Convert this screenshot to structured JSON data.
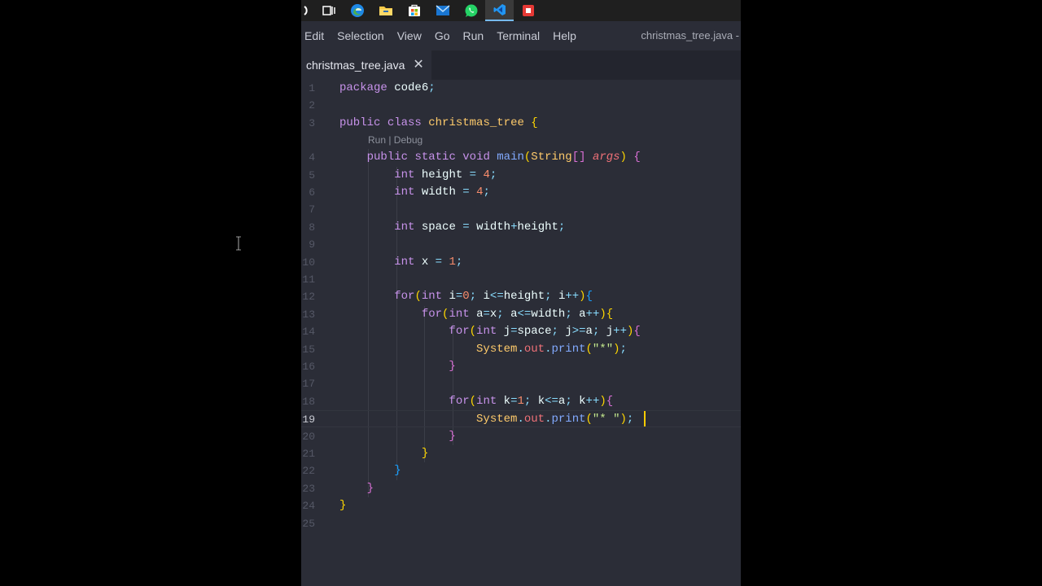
{
  "taskbar": {
    "icons": [
      "power-icon",
      "task-view-icon",
      "edge-browser-icon",
      "file-explorer-icon",
      "store-icon",
      "mail-icon",
      "whatsapp-icon",
      "vscode-icon",
      "office-icon"
    ]
  },
  "menu": {
    "items": [
      "Edit",
      "Selection",
      "View",
      "Go",
      "Run",
      "Terminal",
      "Help"
    ],
    "window_title": "christmas_tree.java -"
  },
  "tab": {
    "label": "christmas_tree.java",
    "close": "✕"
  },
  "editor": {
    "codelens": "Run | Debug",
    "current_line": 19,
    "lines": [
      {
        "n": "1",
        "text": "package code6;"
      },
      {
        "n": "2",
        "text": ""
      },
      {
        "n": "3",
        "text": "public class christmas_tree {"
      },
      {
        "n": "4",
        "text": "    public static void main(String[] args) {"
      },
      {
        "n": "5",
        "text": "        int height = 4;"
      },
      {
        "n": "6",
        "text": "        int width = 4;"
      },
      {
        "n": "7",
        "text": ""
      },
      {
        "n": "8",
        "text": "        int space = width+height;"
      },
      {
        "n": "9",
        "text": ""
      },
      {
        "n": "10",
        "text": "        int x = 1;"
      },
      {
        "n": "11",
        "text": ""
      },
      {
        "n": "12",
        "text": "        for(int i=0; i<=height; i++){"
      },
      {
        "n": "13",
        "text": "            for(int a=x; a<=width; a++){"
      },
      {
        "n": "14",
        "text": "                for(int j=space; j>=a; j++){"
      },
      {
        "n": "15",
        "text": "                    System.out.print(\"*\");"
      },
      {
        "n": "16",
        "text": "                }"
      },
      {
        "n": "17",
        "text": ""
      },
      {
        "n": "18",
        "text": "                for(int k=1; k<=a; k++){"
      },
      {
        "n": "19",
        "text": "                    System.out.print(\"* \");"
      },
      {
        "n": "20",
        "text": "                }"
      },
      {
        "n": "21",
        "text": "            }"
      },
      {
        "n": "22",
        "text": "        }"
      },
      {
        "n": "23",
        "text": "    }"
      },
      {
        "n": "24",
        "text": "}"
      },
      {
        "n": "25",
        "text": ""
      }
    ]
  },
  "colors": {
    "editor_bg": "#2b2d37",
    "keyword": "#c792ea",
    "class_name": "#ffcb6b",
    "function": "#82aaff",
    "number": "#f78c6c",
    "string": "#c3e88d",
    "cursor": "#ffcc00"
  }
}
